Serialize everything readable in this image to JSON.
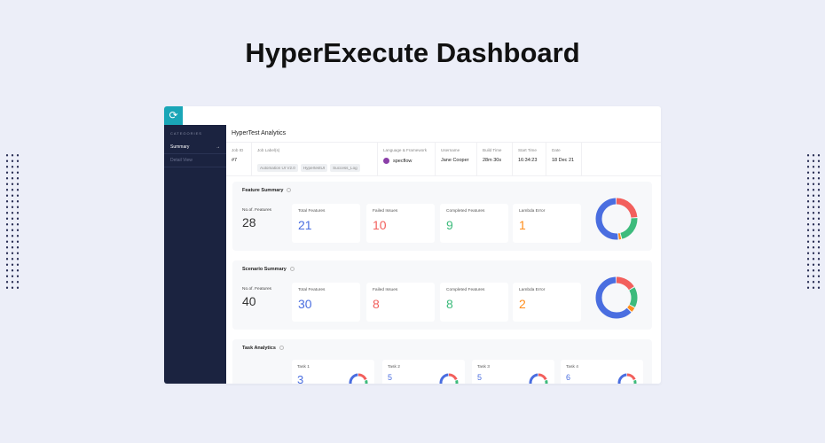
{
  "title": "HyperExecute Dashboard",
  "sidebar": {
    "heading": "CATEGORIES",
    "items": [
      {
        "label": "Summary",
        "arrow": "→"
      },
      {
        "label": "Detail View"
      }
    ]
  },
  "header": {
    "title": "HyperTest Analytics"
  },
  "meta": {
    "job_id": {
      "label": "Job ID",
      "value": "#7"
    },
    "job_labels": {
      "label": "Job Label(s)",
      "tags": [
        "Automation UI V2.0",
        "HypertestUI",
        "Success_Log"
      ]
    },
    "framework": {
      "label": "Language & Framework",
      "value": "specflow"
    },
    "username": {
      "label": "Username",
      "value": "Jane Cooper"
    },
    "build_time": {
      "label": "Build Time",
      "value": "28m 30s"
    },
    "start_time": {
      "label": "Start Time",
      "value": "16:34:23"
    },
    "date": {
      "label": "Date",
      "value": "18 Dec 21"
    }
  },
  "feature": {
    "title": "Feature Summary",
    "count_label": "No.of. Features",
    "count": "28",
    "boxes": [
      {
        "label": "Total Features",
        "value": "21"
      },
      {
        "label": "Failed Issues",
        "value": "10"
      },
      {
        "label": "Completed Features",
        "value": "9"
      },
      {
        "label": "Lambda Error",
        "value": "1"
      }
    ]
  },
  "scenario": {
    "title": "Scenario Summary",
    "count_label": "No.of. Features",
    "count": "40",
    "boxes": [
      {
        "label": "Total Features",
        "value": "30"
      },
      {
        "label": "Failed Issues",
        "value": "8"
      },
      {
        "label": "Completed Features",
        "value": "8"
      },
      {
        "label": "Lambda Error",
        "value": "2"
      }
    ]
  },
  "tasks": {
    "title": "Task Analytics",
    "items": [
      {
        "label": "Task 1",
        "value": "3"
      },
      {
        "label": "Task 2",
        "value": "5"
      },
      {
        "label": "Task 3",
        "value": "5"
      },
      {
        "label": "Task 4",
        "value": "6"
      }
    ]
  },
  "colors": {
    "blue": "#4a6ee0",
    "red": "#f25f5c",
    "green": "#3dbb7c",
    "orange": "#ff8c1a"
  }
}
